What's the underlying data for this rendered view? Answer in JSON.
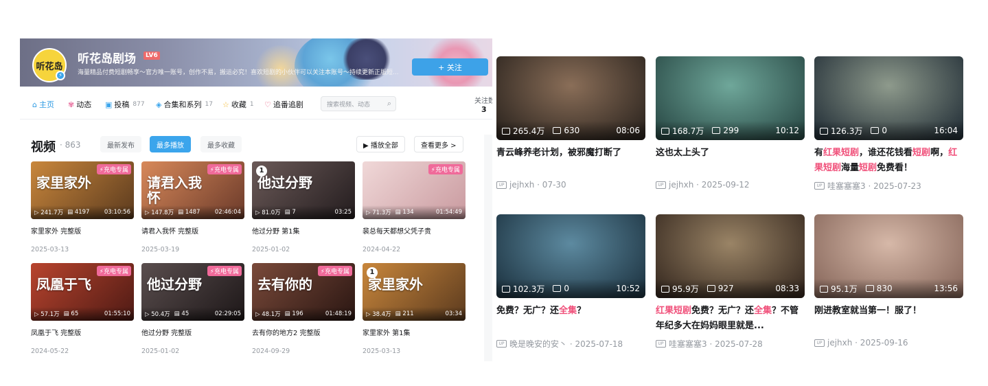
{
  "channel": {
    "avatar_text": "听花岛",
    "name": "听花岛剧场",
    "level": "LV6",
    "sign": "海量精品付费短剧畅享～官方唯一账号，创作不易，搬运必究！喜欢短剧的小伙伴可以关注本账号～持续更新正版短...",
    "follow_label": "+ 关注"
  },
  "nav": {
    "home": "主页",
    "dynamic": "动态",
    "uploads": "投稿",
    "uploads_count": "877",
    "collections": "合集和系列",
    "collections_count": "17",
    "favorites": "收藏",
    "favorites_count": "1",
    "bangumi": "追番追剧",
    "search_placeholder": "搜索视频、动态",
    "fans_label": "关注数",
    "fans_value": "3"
  },
  "section": {
    "title": "视频",
    "count": "· 863",
    "sort_new": "最新发布",
    "sort_play": "最多播放",
    "sort_fav": "最多收藏",
    "play_all": "▶ 播放全部",
    "more": "查看更多 >"
  },
  "tag_label": "⚡充电专属",
  "videos": [
    {
      "title": "家里家外 完整版",
      "date": "2025-03-13",
      "views": "241.7万",
      "danmaku": "4197",
      "duration": "03:10:56",
      "tag": true,
      "overlay": "家里家外",
      "c1": "#c9873c",
      "c2": "#5b3a1e",
      "rank": ""
    },
    {
      "title": "请君入我怀 完整版",
      "date": "2025-03-19",
      "views": "147.8万",
      "danmaku": "1487",
      "duration": "02:46:04",
      "tag": true,
      "overlay": "请君入我怀",
      "c1": "#d8895a",
      "c2": "#6b3a2a",
      "rank": ""
    },
    {
      "title": "他过分野 第1集",
      "date": "2025-01-02",
      "views": "81.0万",
      "danmaku": "7",
      "duration": "03:25",
      "tag": false,
      "overlay": "他过分野",
      "c1": "#6b5a58",
      "c2": "#231c1e",
      "rank": "1"
    },
    {
      "title": "裴总每天都想父凭子贵",
      "date": "2024-04-22",
      "views": "71.3万",
      "danmaku": "134",
      "duration": "01:54:49",
      "tag": true,
      "overlay": "",
      "c1": "#f0d8d8",
      "c2": "#c99a9f",
      "rank": ""
    },
    {
      "title": "凤凰于飞 完整版",
      "date": "2024-05-22",
      "views": "57.1万",
      "danmaku": "65",
      "duration": "01:55:10",
      "tag": true,
      "overlay": "凤凰于飞",
      "c1": "#b8442e",
      "c2": "#4e1a14",
      "rank": ""
    },
    {
      "title": "他过分野 完整版",
      "date": "2025-01-02",
      "views": "50.4万",
      "danmaku": "45",
      "duration": "02:29:05",
      "tag": true,
      "overlay": "他过分野",
      "c1": "#5a4e4e",
      "c2": "#1d1718",
      "rank": ""
    },
    {
      "title": "去有你的地方2 完整版",
      "date": "2024-09-29",
      "views": "48.1万",
      "danmaku": "196",
      "duration": "01:48:19",
      "tag": true,
      "overlay": "去有你的",
      "c1": "#7a4a3a",
      "c2": "#2a1612",
      "rank": ""
    },
    {
      "title": "家里家外 第1集",
      "date": "2025-03-13",
      "views": "38.4万",
      "danmaku": "211",
      "duration": "03:34",
      "tag": false,
      "overlay": "家里家外",
      "c1": "#c9873c",
      "c2": "#5b3a1e",
      "rank": "1"
    }
  ],
  "right_videos": [
    {
      "title_parts": [
        {
          "t": "青云峰养老计划，被邪魔打断了",
          "hl": false
        }
      ],
      "author": "jejhxh · 07-30",
      "views": "265.4万",
      "danmaku": "630",
      "duration": "08:06",
      "c1": "#8a6e58",
      "c2": "#2e2620"
    },
    {
      "title_parts": [
        {
          "t": "这也太上头了",
          "hl": false
        }
      ],
      "author": "jejhxh · 2025-09-12",
      "views": "168.7万",
      "danmaku": "299",
      "duration": "10:12",
      "c1": "#6fa79a",
      "c2": "#2b4c48"
    },
    {
      "title_parts": [
        {
          "t": "有",
          "hl": false
        },
        {
          "t": "红果短剧",
          "hl": true
        },
        {
          "t": "，谁还花钱看",
          "hl": false
        },
        {
          "t": "短剧",
          "hl": true
        },
        {
          "t": "啊，",
          "hl": false
        },
        {
          "t": "红果短剧",
          "hl": true
        },
        {
          "t": "海量",
          "hl": false
        },
        {
          "t": "短剧",
          "hl": true
        },
        {
          "t": "免费看！",
          "hl": false
        }
      ],
      "author": "哇塞塞塞3 · 2025-07-23",
      "views": "126.3万",
      "danmaku": "0",
      "duration": "16:04",
      "c1": "#8e9a8c",
      "c2": "#26323a"
    },
    {
      "title_parts": [
        {
          "t": "免费？无广？还",
          "hl": false
        },
        {
          "t": "全集",
          "hl": true
        },
        {
          "t": "？",
          "hl": false
        }
      ],
      "author": "晚是晚安的安丶 · 2025-07-18",
      "views": "102.3万",
      "danmaku": "0",
      "duration": "10:52",
      "c1": "#5d8aa0",
      "c2": "#1f3644"
    },
    {
      "title_parts": [
        {
          "t": "红果短剧",
          "hl": true
        },
        {
          "t": "免费？无广？还",
          "hl": false
        },
        {
          "t": "全集",
          "hl": true
        },
        {
          "t": "？不管年纪多大在妈妈眼里就是...",
          "hl": false
        }
      ],
      "author": "哇塞塞塞3 · 2025-07-28",
      "views": "95.9万",
      "danmaku": "927",
      "duration": "08:33",
      "c1": "#9a8466",
      "c2": "#3a2c22"
    },
    {
      "title_parts": [
        {
          "t": "刚进教室就当第一！服了！",
          "hl": false
        }
      ],
      "author": "jejhxh · 2025-09-16",
      "views": "95.1万",
      "danmaku": "830",
      "duration": "13:56",
      "c1": "#d6b8a8",
      "c2": "#8a6a5e"
    }
  ]
}
